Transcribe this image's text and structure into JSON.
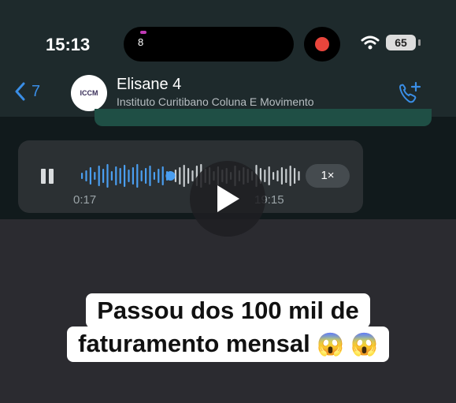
{
  "status_bar": {
    "time": "15:13",
    "island_badge": "8",
    "battery": "65"
  },
  "header": {
    "back_count": "7",
    "avatar_text": "ICCM",
    "contact_name": "Elisane 4",
    "contact_subtitle": "Instituto Curitibano Coluna E Movimento"
  },
  "audio_message": {
    "elapsed": "0:17",
    "duration": "19:15",
    "speed": "1×",
    "progress": 0.4
  },
  "caption": {
    "line1": "Passou dos 100 mil de",
    "line2": "faturamento mensal",
    "emoji": "😱 😱"
  },
  "colors": {
    "accent": "#3a8ee6",
    "record": "#e8453c",
    "wave_played": "#4a9ef0",
    "wave_unplayed": "#c8cdd0"
  }
}
